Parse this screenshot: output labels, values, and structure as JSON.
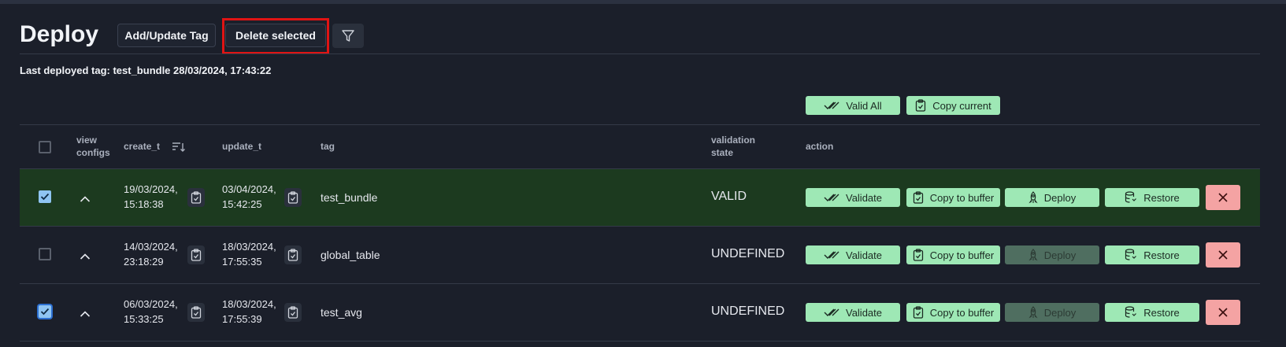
{
  "header": {
    "title": "Deploy",
    "add_update_tag": "Add/Update Tag",
    "delete_selected": "Delete selected",
    "filter_icon": "filter-icon"
  },
  "last_deployed": "Last deployed tag: test_bundle 28/03/2024, 17:43:22",
  "bulk_actions": {
    "valid_all": "Valid All",
    "copy_current": "Copy current"
  },
  "columns": {
    "view_configs_1": "view",
    "view_configs_2": "configs",
    "create_t": "create_t",
    "update_t": "update_t",
    "tag": "tag",
    "validation_state_1": "validation",
    "validation_state_2": "state",
    "action": "action"
  },
  "actions": {
    "validate": "Validate",
    "copy": "Copy to buffer",
    "deploy": "Deploy",
    "restore": "Restore"
  },
  "rows": [
    {
      "checked": true,
      "create_date": "19/03/2024,",
      "create_time": "15:18:38",
      "update_date": "03/04/2024,",
      "update_time": "15:42:25",
      "tag": "test_bundle",
      "state": "VALID",
      "deploy_enabled": true
    },
    {
      "checked": false,
      "create_date": "14/03/2024,",
      "create_time": "23:18:29",
      "update_date": "18/03/2024,",
      "update_time": "17:55:35",
      "tag": "global_table",
      "state": "UNDEFINED",
      "deploy_enabled": false
    },
    {
      "checked": true,
      "create_date": "06/03/2024,",
      "create_time": "15:33:25",
      "update_date": "18/03/2024,",
      "update_time": "17:55:39",
      "tag": "test_avg",
      "state": "UNDEFINED",
      "deploy_enabled": false
    }
  ],
  "colors": {
    "background": "#1b1f2a",
    "selected_row": "#1c3a1f",
    "green_button": "#9ee8b5",
    "red_button": "#f4a3a3",
    "highlight_border": "#e01414"
  }
}
